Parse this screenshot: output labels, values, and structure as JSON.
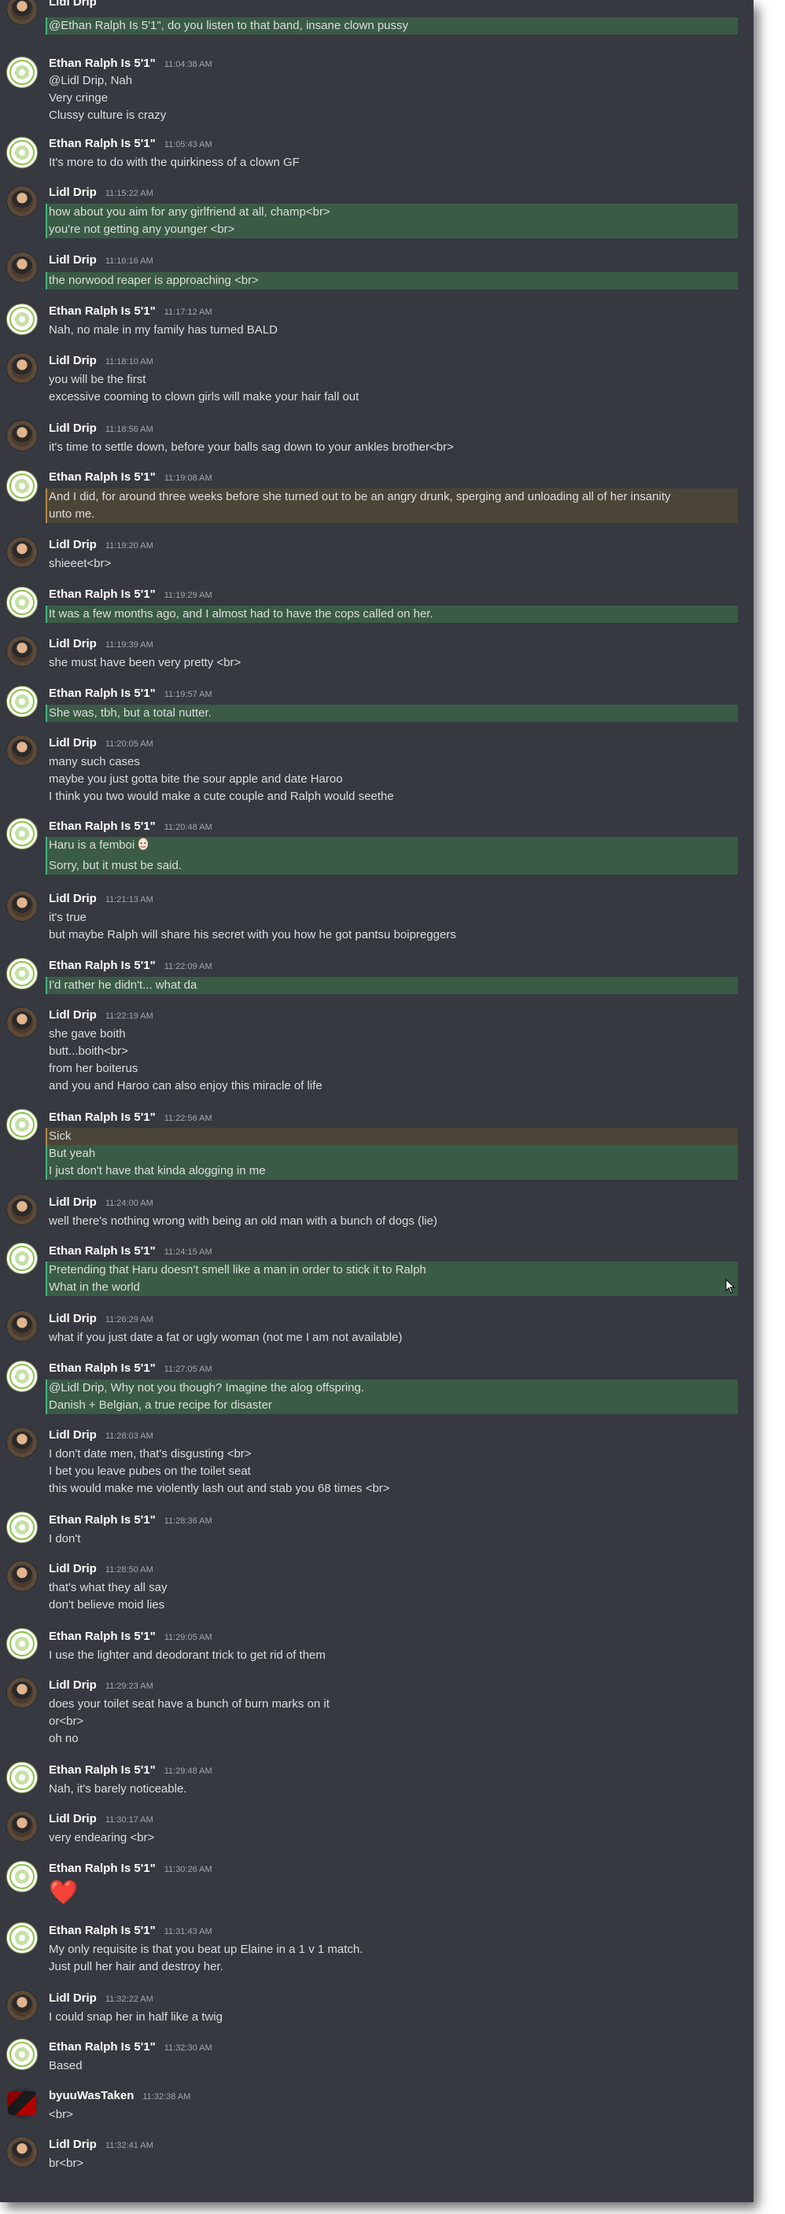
{
  "colors": {
    "background": "#36393f",
    "text": "#dcddde",
    "username": "#ffffff",
    "timestamp": "#a3a6aa",
    "mention_highlight": "#3a5b45",
    "highlight_bar": "#43b581"
  },
  "icons": {
    "avatar_ralph": "green-circle-logo-avatar",
    "avatar_lidl": "photo-avatar",
    "avatar_byuu": "red-black-avatar",
    "emoji_femboi": "face-emoji",
    "emoji_heart": "red-heart-emoji",
    "cursor": "mouse-cursor"
  },
  "messages": [
    {
      "author": "Lidl Drip",
      "time": "",
      "lines": [
        "@Ethan Ralph Is 5'1\", do you listen to that band, insane clown pussy"
      ]
    },
    {
      "author": "Ethan Ralph Is 5'1\"",
      "time": "11:04:38 AM",
      "lines": [
        "@Lidl Drip, Nah",
        "Very cringe",
        "Clussy culture is crazy"
      ]
    },
    {
      "author": "Ethan Ralph Is 5'1\"",
      "time": "11:05:43 AM",
      "lines": [
        "It's more to do with the quirkiness of a clown GF"
      ]
    },
    {
      "author": "Lidl Drip",
      "time": "11:15:22 AM",
      "lines": [
        "how about you aim for any girlfriend at all, champ<br>",
        "you're not getting any younger <br>"
      ]
    },
    {
      "author": "Lidl Drip",
      "time": "11:16:16 AM",
      "lines": [
        "the norwood reaper is approaching <br>"
      ]
    },
    {
      "author": "Ethan Ralph Is 5'1\"",
      "time": "11:17:12 AM",
      "lines": [
        "Nah, no male in my family has turned BALD"
      ]
    },
    {
      "author": "Lidl Drip",
      "time": "11:18:10 AM",
      "lines": [
        "you will be the first",
        "excessive cooming to clown girls will make your hair fall out"
      ]
    },
    {
      "author": "Lidl Drip",
      "time": "11:18:56 AM",
      "lines": [
        "it's time to settle down, before your balls sag down to your ankles brother<br>"
      ]
    },
    {
      "author": "Ethan Ralph Is 5'1\"",
      "time": "11:19:08 AM",
      "lines": [
        "And I did, for around three weeks before she turned out to be an angry drunk, sperging and unloading all of her insanity",
        "unto me."
      ]
    },
    {
      "author": "Lidl Drip",
      "time": "11:19:20 AM",
      "lines": [
        "shieeet<br>"
      ]
    },
    {
      "author": "Ethan Ralph Is 5'1\"",
      "time": "11:19:29 AM",
      "lines": [
        "It was a few months ago, and I almost had to have the cops called on her."
      ]
    },
    {
      "author": "Lidl Drip",
      "time": "11:19:39 AM",
      "lines": [
        "she must have been very pretty <br>"
      ]
    },
    {
      "author": "Ethan Ralph Is 5'1\"",
      "time": "11:19:57 AM",
      "lines": [
        "She was, tbh, but a total nutter."
      ]
    },
    {
      "author": "Lidl Drip",
      "time": "11:20:05 AM",
      "lines": [
        "many such cases",
        "maybe you just gotta bite the sour apple and date Haroo",
        "I think you two would make a cute couple and Ralph would seethe"
      ]
    },
    {
      "author": "Ethan Ralph Is 5'1\"",
      "time": "11:20:48 AM",
      "lines": [
        "Haru is a femboi",
        "Sorry, but it must be said."
      ]
    },
    {
      "author": "Lidl Drip",
      "time": "11:21:13 AM",
      "lines": [
        "it's true",
        "but maybe Ralph will share his secret with you how he got pantsu boipreggers"
      ]
    },
    {
      "author": "Ethan Ralph Is 5'1\"",
      "time": "11:22:09 AM",
      "lines": [
        "I'd rather he didn't... what da"
      ]
    },
    {
      "author": "Lidl Drip",
      "time": "11:22:19 AM",
      "lines": [
        "she gave boith",
        "butt...boith<br>",
        "from her boiterus",
        "and you and Haroo can also enjoy this miracle of life"
      ]
    },
    {
      "author": "Ethan Ralph Is 5'1\"",
      "time": "11:22:56 AM",
      "lines": [
        "Sick",
        "But yeah",
        "I just don't have that kinda alogging in me"
      ]
    },
    {
      "author": "Lidl Drip",
      "time": "11:24:00 AM",
      "lines": [
        "well there's nothing wrong with being an old man with a bunch of dogs (lie)"
      ]
    },
    {
      "author": "Ethan Ralph Is 5'1\"",
      "time": "11:24:15 AM",
      "lines": [
        "Pretending that Haru doesn't smell like a man in order to stick it to Ralph",
        "What in the world"
      ]
    },
    {
      "author": "Lidl Drip",
      "time": "11:26:29 AM",
      "lines": [
        "what if you just date a fat or ugly woman (not me I am not available)"
      ]
    },
    {
      "author": "Ethan Ralph Is 5'1\"",
      "time": "11:27:05 AM",
      "lines": [
        "@Lidl Drip, Why not you though? Imagine the alog offspring.",
        "Danish + Belgian, a true recipe for disaster"
      ]
    },
    {
      "author": "Lidl Drip",
      "time": "11:28:03 AM",
      "lines": [
        "I don't date men, that's disgusting <br>",
        "I bet you leave pubes on the toilet seat",
        "this would make me violently lash out and stab you 68 times <br>"
      ]
    },
    {
      "author": "Ethan Ralph Is 5'1\"",
      "time": "11:28:36 AM",
      "lines": [
        "I don't"
      ]
    },
    {
      "author": "Lidl Drip",
      "time": "11:28:50 AM",
      "lines": [
        "that's what they all say",
        "don't believe moid lies"
      ]
    },
    {
      "author": "Ethan Ralph Is 5'1\"",
      "time": "11:29:05 AM",
      "lines": [
        "I use the lighter and deodorant trick to get rid of them"
      ]
    },
    {
      "author": "Lidl Drip",
      "time": "11:29:23 AM",
      "lines": [
        "does your toilet seat have a bunch of burn marks on it",
        "or<br>",
        "oh no"
      ]
    },
    {
      "author": "Ethan Ralph Is 5'1\"",
      "time": "11:29:48 AM",
      "lines": [
        "Nah, it's barely noticeable."
      ]
    },
    {
      "author": "Lidl Drip",
      "time": "11:30:17 AM",
      "lines": [
        "very endearing <br>"
      ]
    },
    {
      "author": "Ethan Ralph Is 5'1\"",
      "time": "11:30:26 AM",
      "lines": [
        "❤️"
      ]
    },
    {
      "author": "Ethan Ralph Is 5'1\"",
      "time": "11:31:43 AM",
      "lines": [
        "My only requisite is that you beat up Elaine in a 1 v 1 match.",
        "Just pull her hair and destroy her."
      ]
    },
    {
      "author": "Lidl Drip",
      "time": "11:32:22 AM",
      "lines": [
        "I could snap her in half like a twig"
      ]
    },
    {
      "author": "Ethan Ralph Is 5'1\"",
      "time": "11:32:30 AM",
      "lines": [
        "Based"
      ]
    },
    {
      "author": "byuuWasTaken",
      "time": "11:32:38 AM",
      "lines": [
        "<br>"
      ]
    },
    {
      "author": "Lidl Drip",
      "time": "11:32:41 AM",
      "lines": [
        "br<br>"
      ]
    }
  ]
}
